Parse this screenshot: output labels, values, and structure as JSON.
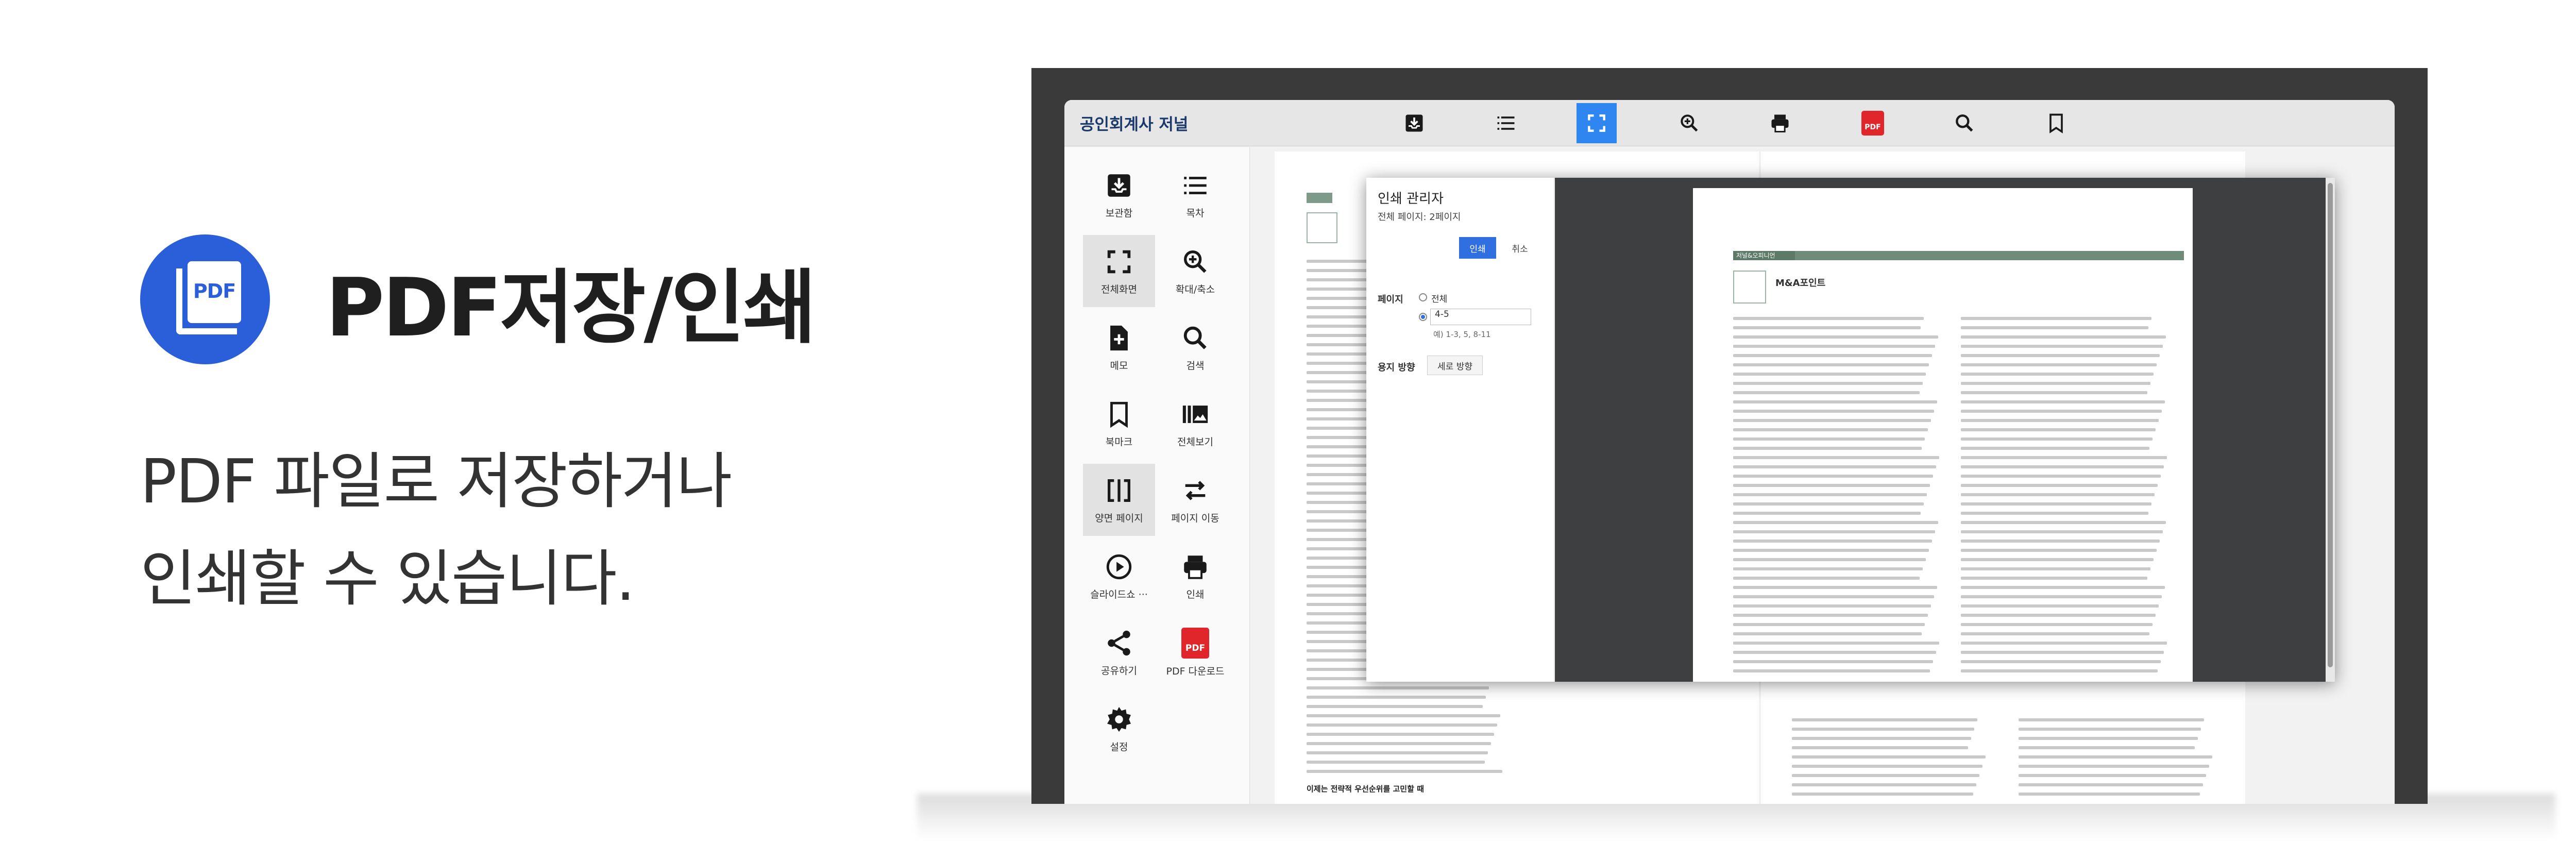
{
  "promo": {
    "icon": "pdf-file-icon",
    "icon_text": "PDF",
    "title": "PDF저장/인쇄",
    "description_line1": "PDF 파일로 저장하거나",
    "description_line2": "인쇄할 수 있습니다.",
    "accent_color": "#2b5fd9"
  },
  "viewer": {
    "brand": "공인회계사 저널",
    "toolbar_icons": [
      "save-box-icon",
      "list-icon",
      "fullscreen-icon",
      "zoom-in-icon",
      "print-icon",
      "pdf-icon",
      "search-icon",
      "bookmark-icon"
    ],
    "toolbar_pdf_text": "PDF",
    "active_toolbar": "fullscreen-icon",
    "sidebar": [
      {
        "label": "보관함",
        "icon": "save-box-icon"
      },
      {
        "label": "목차",
        "icon": "list-icon"
      },
      {
        "label": "전체화면",
        "icon": "fullscreen-icon",
        "active": true
      },
      {
        "label": "확대/축소",
        "icon": "zoom-in-icon"
      },
      {
        "label": "메모",
        "icon": "note-add-icon"
      },
      {
        "label": "검색",
        "icon": "search-icon"
      },
      {
        "label": "북마크",
        "icon": "bookmark-icon"
      },
      {
        "label": "전체보기",
        "icon": "grid-view-icon"
      },
      {
        "label": "양면 페이지",
        "icon": "double-page-icon",
        "active": true
      },
      {
        "label": "페이지 이동",
        "icon": "swap-arrows-icon"
      },
      {
        "label": "슬라이드쇼 ···",
        "icon": "play-icon"
      },
      {
        "label": "인쇄",
        "icon": "print-icon"
      },
      {
        "label": "공유하기",
        "icon": "share-icon"
      },
      {
        "label": "PDF 다운로드",
        "icon": "pdf-icon",
        "badge": "PDF"
      },
      {
        "label": "설정",
        "icon": "gear-icon"
      }
    ],
    "page_heading": "이제는 전략적 우선순위를 고민할 때",
    "accent_color": "#2f86f0"
  },
  "print_dialog": {
    "title": "인쇄 관리자",
    "total_pages": "전체 페이지: 2페이지",
    "print_button": "인쇄",
    "cancel_button": "취소",
    "pages_label": "페이지",
    "option_all": "전체",
    "range_value": "4-5",
    "range_hint": "예) 1-3, 5, 8-11",
    "orientation_label": "용지 방향",
    "orientation_value": "세로 방향",
    "preview_section_tag": "저널&오피니언",
    "preview_title": "M&A포인트"
  }
}
